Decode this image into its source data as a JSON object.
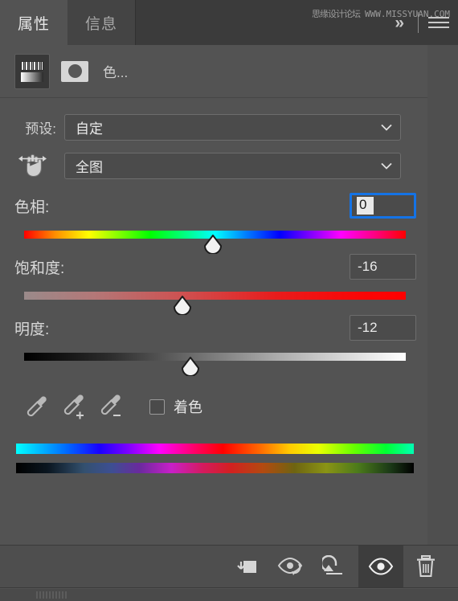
{
  "panel": {
    "tabs": [
      {
        "label": "属性",
        "name": "tab-properties",
        "active": true
      },
      {
        "label": "信息",
        "name": "tab-info",
        "active": false
      }
    ],
    "watermark_cn": "思缘设计论坛",
    "watermark_url": "WWW.MISSYUAN.COM",
    "collapse_icon": "»",
    "menu_icon": "hamburger-icon",
    "background_color": "#535353",
    "accent_color": "#1473e6"
  },
  "adjustment": {
    "icon_name": "hue-saturation-icon",
    "mask_icon_name": "layer-mask-thumbnail",
    "title": "色..."
  },
  "preset": {
    "label": "预设:",
    "value": "自定",
    "chevron_icon": "chevron-down-icon"
  },
  "channel": {
    "hand_icon": "on-image-adjust-hand-icon",
    "value": "全图",
    "chevron_icon": "chevron-down-icon"
  },
  "sliders": [
    {
      "id": "hue",
      "label": "色相:",
      "value": "0",
      "thumb_percent": 49.5,
      "focused": true,
      "track_name": "hue-gradient-track",
      "thumb_name": "hue-slider-thumb",
      "field_name": "hue-value-field"
    },
    {
      "id": "saturation",
      "label": "饱和度:",
      "value": "-16",
      "thumb_percent": 41.5,
      "focused": false,
      "track_name": "saturation-gradient-track",
      "thumb_name": "saturation-slider-thumb",
      "field_name": "saturation-value-field"
    },
    {
      "id": "lightness",
      "label": "明度:",
      "value": "-12",
      "thumb_percent": 43.6,
      "focused": false,
      "track_name": "lightness-gradient-track",
      "thumb_name": "lightness-slider-thumb",
      "field_name": "lightness-value-field"
    }
  ],
  "tools": {
    "eyedroppers": [
      {
        "name": "eyedropper-sample-icon"
      },
      {
        "name": "eyedropper-add-icon",
        "modifier": "+"
      },
      {
        "name": "eyedropper-subtract-icon",
        "modifier": "−"
      }
    ],
    "colorize": {
      "label": "着色",
      "checked": false
    }
  },
  "spectrum": {
    "top_bar_name": "source-color-range-bar",
    "bottom_bar_name": "result-color-range-bar"
  },
  "bottom_toolbar": {
    "buttons": [
      {
        "name": "clip-to-layer-button",
        "active": false
      },
      {
        "name": "view-previous-state-button",
        "active": false
      },
      {
        "name": "reset-adjustment-button",
        "active": false
      },
      {
        "name": "toggle-visibility-button",
        "active": true
      },
      {
        "name": "delete-adjustment-button",
        "active": false
      }
    ]
  }
}
